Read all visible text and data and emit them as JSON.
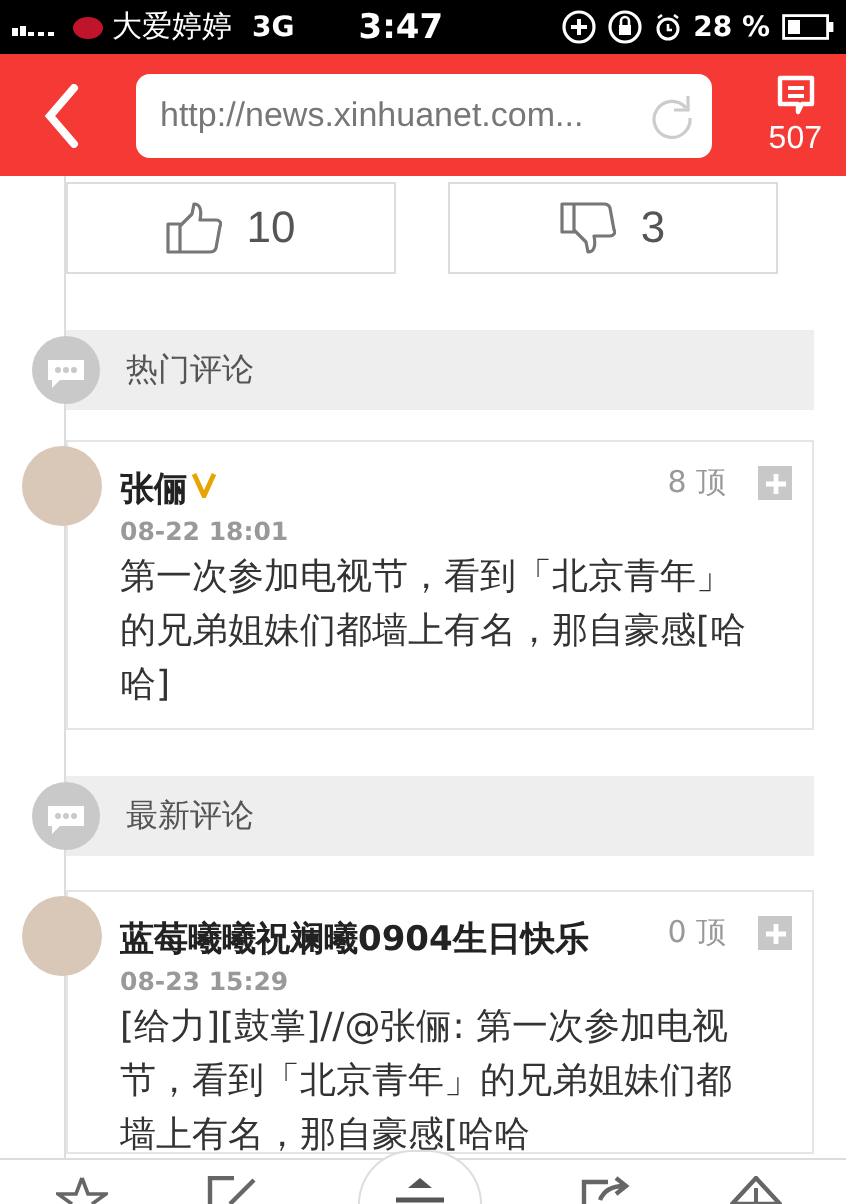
{
  "status_bar": {
    "carrier": "大爱婷婷",
    "network": "3G",
    "time": "3:47",
    "battery": "28 %"
  },
  "header": {
    "url": "http://news.xinhuanet.com...",
    "comment_count": "507"
  },
  "votes": [
    {
      "kind": "up",
      "count": "10"
    },
    {
      "kind": "down",
      "count": "3"
    }
  ],
  "sections": [
    {
      "title": "热门评论",
      "comments": [
        {
          "name": "张俪",
          "verified": true,
          "date": "08-22 18:01",
          "likes": "8 顶",
          "text": "第一次参加电视节，看到「北京青年」的兄弟姐妹们都墙上有名，那自豪感[哈哈]"
        }
      ]
    },
    {
      "title": "最新评论",
      "comments": [
        {
          "name": "蓝莓曦曦祝斓曦0904生日快乐",
          "verified": false,
          "date": "08-23 15:29",
          "likes": "0 顶",
          "text": "[给力][鼓掌]//@张俪: 第一次参加电视节，看到「北京青年」的兄弟姐妹们都墙上有名，那自豪感[哈哈"
        }
      ]
    }
  ],
  "toolbar": [
    {
      "kind": "star"
    },
    {
      "kind": "edit"
    },
    {
      "kind": "up"
    },
    {
      "kind": "share"
    },
    {
      "kind": "warning"
    }
  ]
}
